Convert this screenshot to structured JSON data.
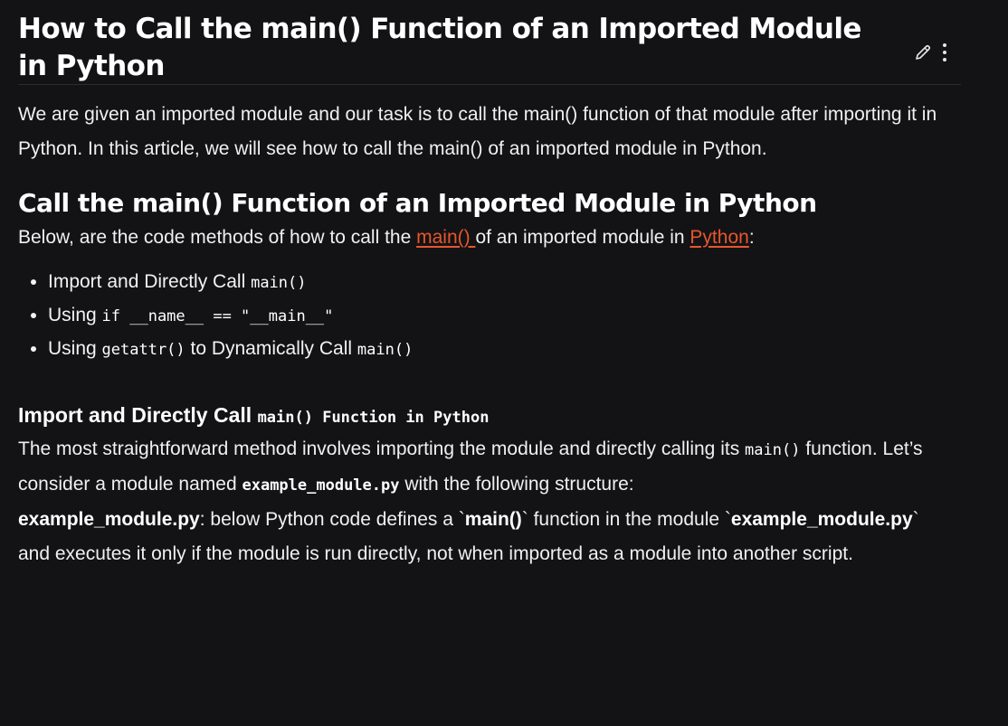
{
  "article": {
    "title": "How to Call the main() Function of an Imported Module in Python",
    "intro": "We are given an imported module and our task is to call the main() function of that module after importing it in Python. In this article, we will see how to call the main() of an imported module in Python."
  },
  "toolbar": {
    "edit_icon": "pencil-icon",
    "more_icon": "more-vertical-icon"
  },
  "section": {
    "heading": "Call the main() Function of an Imported Module in Python",
    "methods_intro_pre": "Below, are the code methods of how to call the ",
    "methods_intro_link1": "main() ",
    "methods_intro_mid": "of an imported module in ",
    "methods_intro_link2": "Python",
    "methods_intro_post": ":",
    "methods": [
      {
        "pre": "Import and Directly Call ",
        "code": "main()",
        "post": ""
      },
      {
        "pre": "Using ",
        "code": "if __name__ == \"__main__\"",
        "post": ""
      },
      {
        "pre": "Using ",
        "code": "getattr()",
        "post": " to Dynamically Call ",
        "code2": "main()"
      }
    ]
  },
  "subsection": {
    "heading_text": "Import and Directly Call ",
    "heading_code": "main() Function in Python",
    "p1_pre": "The most straightforward method involves importing the module and directly calling its ",
    "p1_code": "main()",
    "p1_mid": " function. Let’s consider a module named ",
    "p1_code2": "example_module.py",
    "p1_post": " with the following structure:",
    "p2_bold1": "example_module.py",
    "p2_a": ": below Python code defines a `",
    "p2_bold2": "main()",
    "p2_b": "` function in the module `",
    "p2_bold3": "example_module.py",
    "p2_c": "` and executes it only if the module is run directly, not when imported as a module into another script."
  },
  "colors": {
    "background": "#131316",
    "text": "#f0f0f0",
    "link": "#e8562b"
  }
}
